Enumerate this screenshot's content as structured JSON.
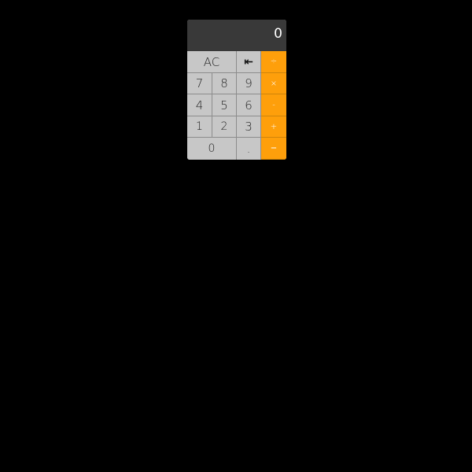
{
  "display": {
    "value": "0"
  },
  "keys": {
    "ac": "AC",
    "backspace": "⇤",
    "divide": "÷",
    "seven": "7",
    "eight": "8",
    "nine": "9",
    "multiply": "×",
    "four": "4",
    "five": "5",
    "six": "6",
    "minus": "-",
    "one": "1",
    "two": "2",
    "three": "3",
    "plus": "+",
    "zero": "0",
    "decimal": ".",
    "equals": "="
  },
  "colors": {
    "background": "#000000",
    "display_bg": "#393939",
    "key_bg": "#c7c7c7",
    "operator_bg": "#fe9f0b"
  }
}
